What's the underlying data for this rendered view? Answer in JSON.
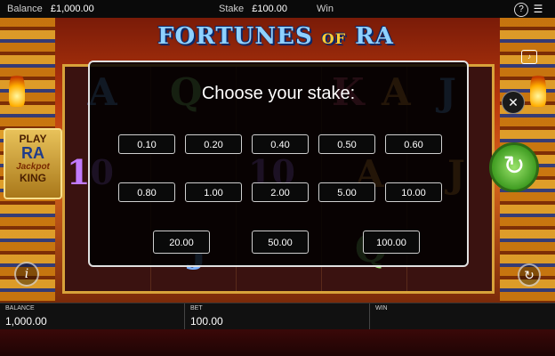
{
  "top_bar": {
    "balance_label": "Balance",
    "balance_value": "£1,000.00",
    "stake_label": "Stake",
    "stake_value": "£100.00",
    "win_label": "Win",
    "help_icon": "?",
    "menu_icon": "☰"
  },
  "game": {
    "title_left": "FORTUNES",
    "title_of": "OF",
    "title_right": "RA",
    "jackpot_line1": "PLAY",
    "jackpot_line2": "RA",
    "jackpot_line3": "Jackpot",
    "jackpot_line4": "KING",
    "info_icon": "i",
    "spin_icon": "↻",
    "auto_icon": "↻",
    "sound_icon": "🔊",
    "reel_symbols": [
      "A",
      "Q",
      "K",
      "A",
      "J",
      "10",
      "J",
      "10",
      "A",
      "Q",
      "J",
      "A"
    ]
  },
  "stake_dialog": {
    "title": "Choose your stake:",
    "close_icon": "✕",
    "options": [
      "0.10",
      "0.20",
      "0.40",
      "0.50",
      "0.60",
      "0.80",
      "1.00",
      "2.00",
      "5.00",
      "10.00",
      "20.00",
      "50.00",
      "100.00"
    ]
  },
  "bottom_bar": {
    "balance_label": "BALANCE",
    "balance_value": "1,000.00",
    "bet_label": "BET",
    "bet_value": "100.00",
    "win_label": "WIN",
    "win_value": ""
  },
  "colors": {
    "accent_gold": "#d8a23a",
    "spin_green": "#3f9c21",
    "title_blue": "#8fd1ff"
  }
}
